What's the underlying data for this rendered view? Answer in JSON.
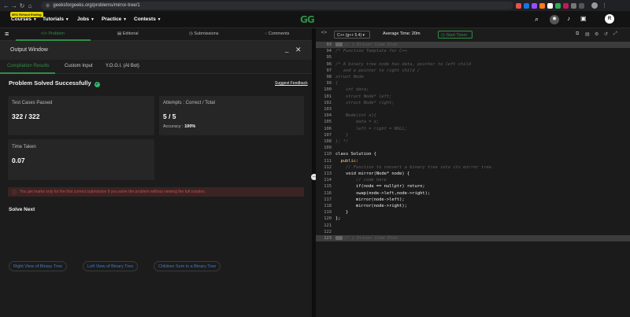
{
  "browser": {
    "url": "geeksforgeeks.org/problems/mirror-tree/1",
    "profile_initial": "R"
  },
  "site_nav": {
    "badge": "30% Refund Ending",
    "items": [
      "Courses",
      "Tutorials",
      "Jobs",
      "Practice",
      "Contests"
    ],
    "logo_text": "GG",
    "user_initial": "R"
  },
  "tabs": {
    "problem": "Problem",
    "editorial": "Editorial",
    "submissions": "Submissions",
    "comments": "Comments"
  },
  "editor_toolbar": {
    "language": "C++ (g++ 5.4)",
    "average_time": "Average Time: 20m",
    "start_timer": "Start Timer"
  },
  "output": {
    "title": "Output Window",
    "tabs": [
      "Compilation Results",
      "Custom Input",
      "Y.O.G.I. (AI Bot)"
    ],
    "status": "Problem Solved Successfully",
    "suggest_feedback": "Suggest Feedback",
    "test_cases_label": "Test Cases Passed",
    "test_cases_value": "322 / 322",
    "attempts_label": "Attempts : Correct / Total",
    "attempts_value": "5 / 5",
    "accuracy_label": "Accuracy :",
    "accuracy_value": "100%",
    "time_label": "Time Taken",
    "time_value": "0.07",
    "note": "You get marks only for the first correct submission if you solve the problem without viewing the full solution.",
    "solve_next_title": "Solve Next",
    "solve_next": [
      "Right View of Binary Tree",
      "Left View of Binary Tree",
      "Children Sum in a Binary Tree"
    ]
  },
  "code_lines": [
    {
      "n": "93",
      "t": "// } Driver Code Ends",
      "s": "fold"
    },
    {
      "n": "94",
      "t": "/* Function Template for C++",
      "s": "cmt"
    },
    {
      "n": "95",
      "t": "",
      "s": "plain"
    },
    {
      "n": "96",
      "t": "/* A binary tree node has data, pointer to left child",
      "s": "cmt"
    },
    {
      "n": "97",
      "t": "   and a pointer to right child /",
      "s": "cmt"
    },
    {
      "n": "98",
      "t": "struct Node",
      "s": "cmt"
    },
    {
      "n": "99",
      "t": "{",
      "s": "cmt"
    },
    {
      "n": "100",
      "t": "    int data;",
      "s": "cmt"
    },
    {
      "n": "101",
      "t": "    struct Node* left;",
      "s": "cmt"
    },
    {
      "n": "102",
      "t": "    struct Node* right;",
      "s": "cmt"
    },
    {
      "n": "103",
      "t": "",
      "s": "cmt"
    },
    {
      "n": "104",
      "t": "    Node(int x){",
      "s": "cmt"
    },
    {
      "n": "105",
      "t": "        data = x;",
      "s": "cmt"
    },
    {
      "n": "106",
      "t": "        left = right = NULL;",
      "s": "cmt"
    },
    {
      "n": "107",
      "t": "    }",
      "s": "cmt"
    },
    {
      "n": "108",
      "t": "}; */",
      "s": "cmt"
    },
    {
      "n": "109",
      "t": "",
      "s": "plain"
    },
    {
      "n": "110",
      "t": "class Solution {",
      "s": "plain"
    },
    {
      "n": "111",
      "t": "  public:",
      "s": "kw"
    },
    {
      "n": "112",
      "t": "    // Function to convert a binary tree into its mirror tree.",
      "s": "cmt"
    },
    {
      "n": "113",
      "t": "    void mirror(Node* node) {",
      "s": "plain"
    },
    {
      "n": "114",
      "t": "        // code here",
      "s": "cmt"
    },
    {
      "n": "115",
      "t": "        if(node == nullptr) return;",
      "s": "plain"
    },
    {
      "n": "116",
      "t": "        swap(node->left,node->right);",
      "s": "plain"
    },
    {
      "n": "117",
      "t": "        mirror(node->left);",
      "s": "plain"
    },
    {
      "n": "118",
      "t": "        mirror(node->right);",
      "s": "plain"
    },
    {
      "n": "119",
      "t": "    }",
      "s": "plain"
    },
    {
      "n": "120",
      "t": "};",
      "s": "plain"
    },
    {
      "n": "121",
      "t": "",
      "s": "plain"
    },
    {
      "n": "122",
      "t": "",
      "s": "plain"
    },
    {
      "n": "123",
      "t": "// } Driver Code Ends",
      "s": "fold"
    }
  ],
  "colors": {
    "accent_green": "#2f8d46",
    "success_icon": "#2fb86a",
    "link_blue": "#3f7cc4",
    "error_red": "#c94c4c"
  }
}
